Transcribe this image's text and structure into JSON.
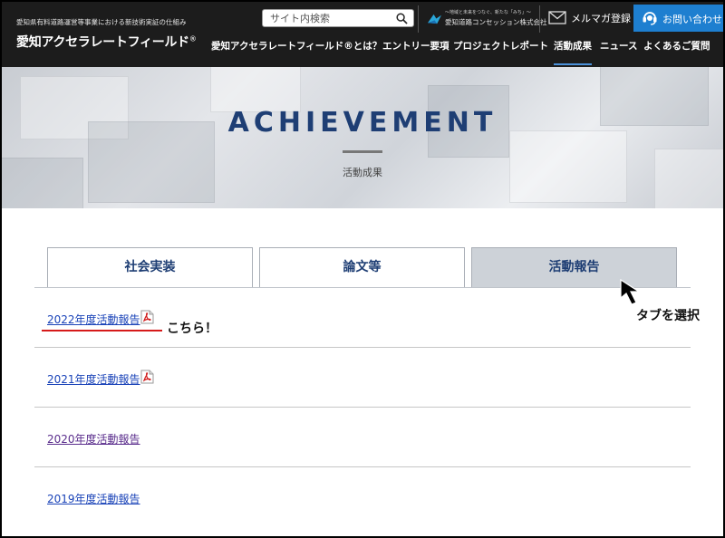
{
  "header": {
    "tagline": "愛知県有料道路運営等事業における新技術実証の仕組み",
    "logo": "愛知アクセラレートフィールド",
    "logo_mark": "®",
    "search_placeholder": "サイト内検索",
    "corp_slogan": "～地域と未来をつなぐ、新たな「みち」～",
    "corp_name": "愛知道路コンセッション株式会社",
    "mail_label": "メルマガ登録",
    "contact_label": "お問い合わせ",
    "nav": [
      {
        "label": "愛知アクセラレートフィールド®とは？"
      },
      {
        "label": "エントリー要項"
      },
      {
        "label": "プロジェクトレポート"
      },
      {
        "label": "活動成果",
        "active": true
      },
      {
        "label": "ニュース"
      },
      {
        "label": "よくあるご質問"
      }
    ]
  },
  "hero": {
    "title": "ACHIEVEMENT",
    "subtitle": "活動成果"
  },
  "tabs": [
    {
      "label": "社会実装",
      "active": false
    },
    {
      "label": "論文等",
      "active": false
    },
    {
      "label": "活動報告",
      "active": true
    }
  ],
  "reports": [
    {
      "label": "2022年度活動報告",
      "has_pdf_icon": true
    },
    {
      "label": "2021年度活動報告",
      "has_pdf_icon": true
    },
    {
      "label": "2020年度活動報告",
      "has_pdf_icon": false
    },
    {
      "label": "2019年度活動報告",
      "has_pdf_icon": false
    }
  ],
  "annotations": {
    "here": "こちら！",
    "select_tab": "タブを選択"
  },
  "colors": {
    "header_bg": "#1c1c1c",
    "contact_bg": "#1e7fd0",
    "title_navy": "#1e3e74",
    "highlight_red": "#d61a1a",
    "active_tab_bg": "#cdd2d8"
  }
}
